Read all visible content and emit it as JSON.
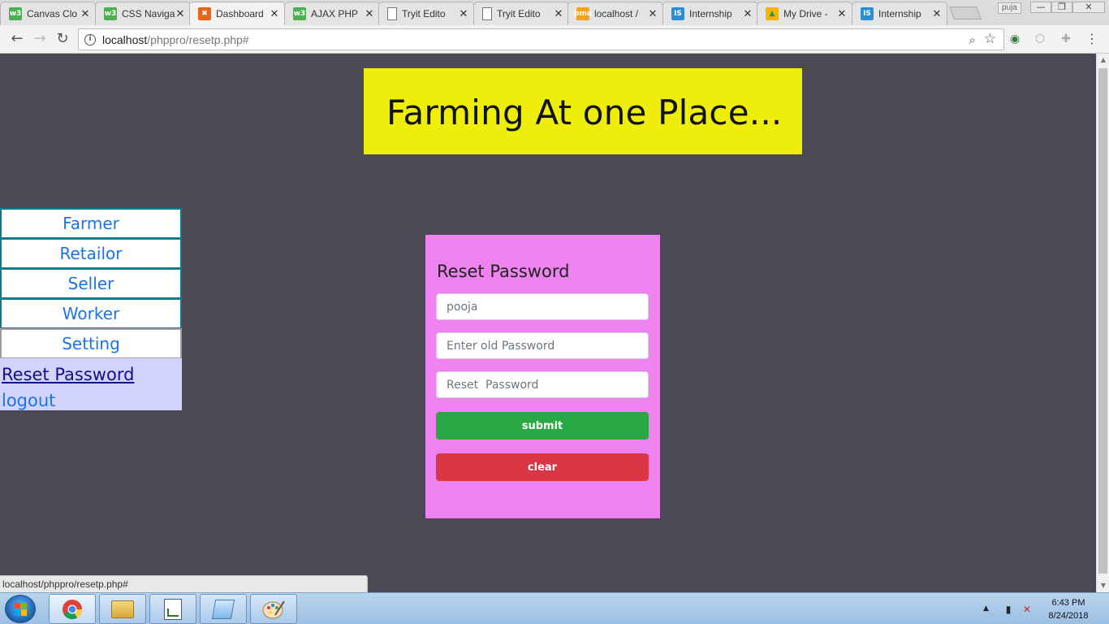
{
  "browser": {
    "tabs": [
      {
        "title": "Canvas Clo",
        "favicon": "w3schools-icon",
        "color": "#4caf50",
        "glyph": "w3"
      },
      {
        "title": "CSS Naviga",
        "favicon": "w3schools-icon",
        "color": "#4caf50",
        "glyph": "w3"
      },
      {
        "title": "Dashboard",
        "favicon": "xampp-icon",
        "color": "#e8641b",
        "glyph": "✖"
      },
      {
        "title": "AJAX PHP",
        "favicon": "w3schools-icon",
        "color": "#4caf50",
        "glyph": "w3"
      },
      {
        "title": "Tryit Edito",
        "favicon": "page-icon",
        "color": "#ffffff",
        "glyph": ""
      },
      {
        "title": "Tryit Edito",
        "favicon": "page-icon",
        "color": "#ffffff",
        "glyph": ""
      },
      {
        "title": "localhost /",
        "favicon": "phpmyadmin-icon",
        "color": "#f7a21b",
        "glyph": "pma"
      },
      {
        "title": "Internship",
        "favicon": "internshala-icon",
        "color": "#2a8fcf",
        "glyph": "IS"
      },
      {
        "title": "My Drive -",
        "favicon": "google-drive-icon",
        "color": "#f4b400",
        "glyph": "▲"
      },
      {
        "title": "Internship",
        "favicon": "internshala-icon",
        "color": "#2a8fcf",
        "glyph": "IS"
      }
    ],
    "active_tab_index": 2,
    "profile_name": "puja",
    "url_host": "localhost",
    "url_path": "/phppro/resetp.php#",
    "status_url": "localhost/phppro/resetp.php#"
  },
  "page": {
    "banner_title": "Farming At one Place...",
    "nav": {
      "farmer": "Farmer",
      "retailor": "Retailor",
      "seller": "Seller",
      "worker": "Worker",
      "setting": "Setting",
      "reset_password": "Reset Password",
      "logout": "logout"
    },
    "form": {
      "heading": "Reset Password",
      "username_value": "pooja",
      "old_password_placeholder": "Enter old Password",
      "new_password_placeholder": "Reset  Password",
      "submit_label": "submit",
      "clear_label": "clear"
    }
  },
  "taskbar": {
    "apps": [
      "chrome-icon",
      "file-explorer-icon",
      "editor-icon",
      "notepad-icon",
      "paint-icon"
    ],
    "time": "6:43 PM",
    "date": "8/24/2018"
  }
}
